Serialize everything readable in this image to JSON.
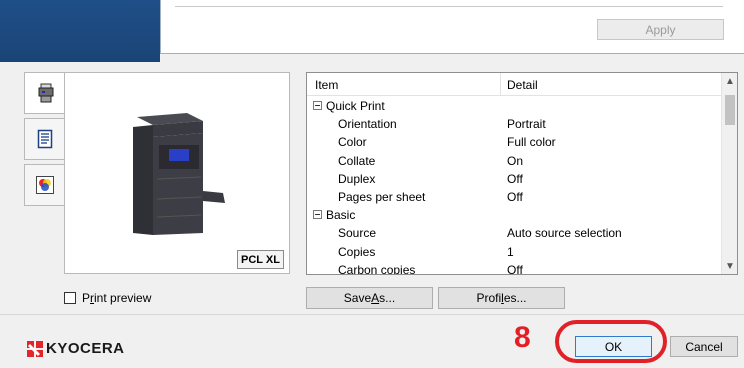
{
  "dialog": {
    "apply_label": "Apply"
  },
  "tabs": [
    {
      "icon": "printer-icon"
    },
    {
      "icon": "document-icon"
    },
    {
      "icon": "color-icon"
    }
  ],
  "preview": {
    "pdl_badge": "PCL XL"
  },
  "settings": {
    "col_item": "Item",
    "col_detail": "Detail",
    "rows": [
      {
        "type": "group",
        "name": "Quick Print",
        "value": ""
      },
      {
        "type": "item",
        "name": "Orientation",
        "value": "Portrait"
      },
      {
        "type": "item",
        "name": "Color",
        "value": "Full color"
      },
      {
        "type": "item",
        "name": "Collate",
        "value": "On"
      },
      {
        "type": "item",
        "name": "Duplex",
        "value": "Off"
      },
      {
        "type": "item",
        "name": "Pages per sheet",
        "value": "Off"
      },
      {
        "type": "group",
        "name": "Basic",
        "value": ""
      },
      {
        "type": "item",
        "name": "Source",
        "value": "Auto source selection"
      },
      {
        "type": "item",
        "name": "Copies",
        "value": "1"
      },
      {
        "type": "item",
        "name": "Carbon copies",
        "value": "Off"
      }
    ]
  },
  "options": {
    "print_preview_label_pre": "P",
    "print_preview_label_u": "r",
    "print_preview_label_post": "int preview",
    "save_as_pre": "Save ",
    "save_as_u": "A",
    "save_as_post": "s...",
    "profiles_pre": "Profi",
    "profiles_u": "l",
    "profiles_post": "es..."
  },
  "footer": {
    "brand": "KYOCERA",
    "step_number": "8",
    "ok_label": "OK",
    "cancel_label": "Cancel"
  },
  "colors": {
    "highlight_ring": "#e02128",
    "step_number": "#e31e24",
    "brand_mark": "#e3262b",
    "desktop": "#1f4f87"
  }
}
